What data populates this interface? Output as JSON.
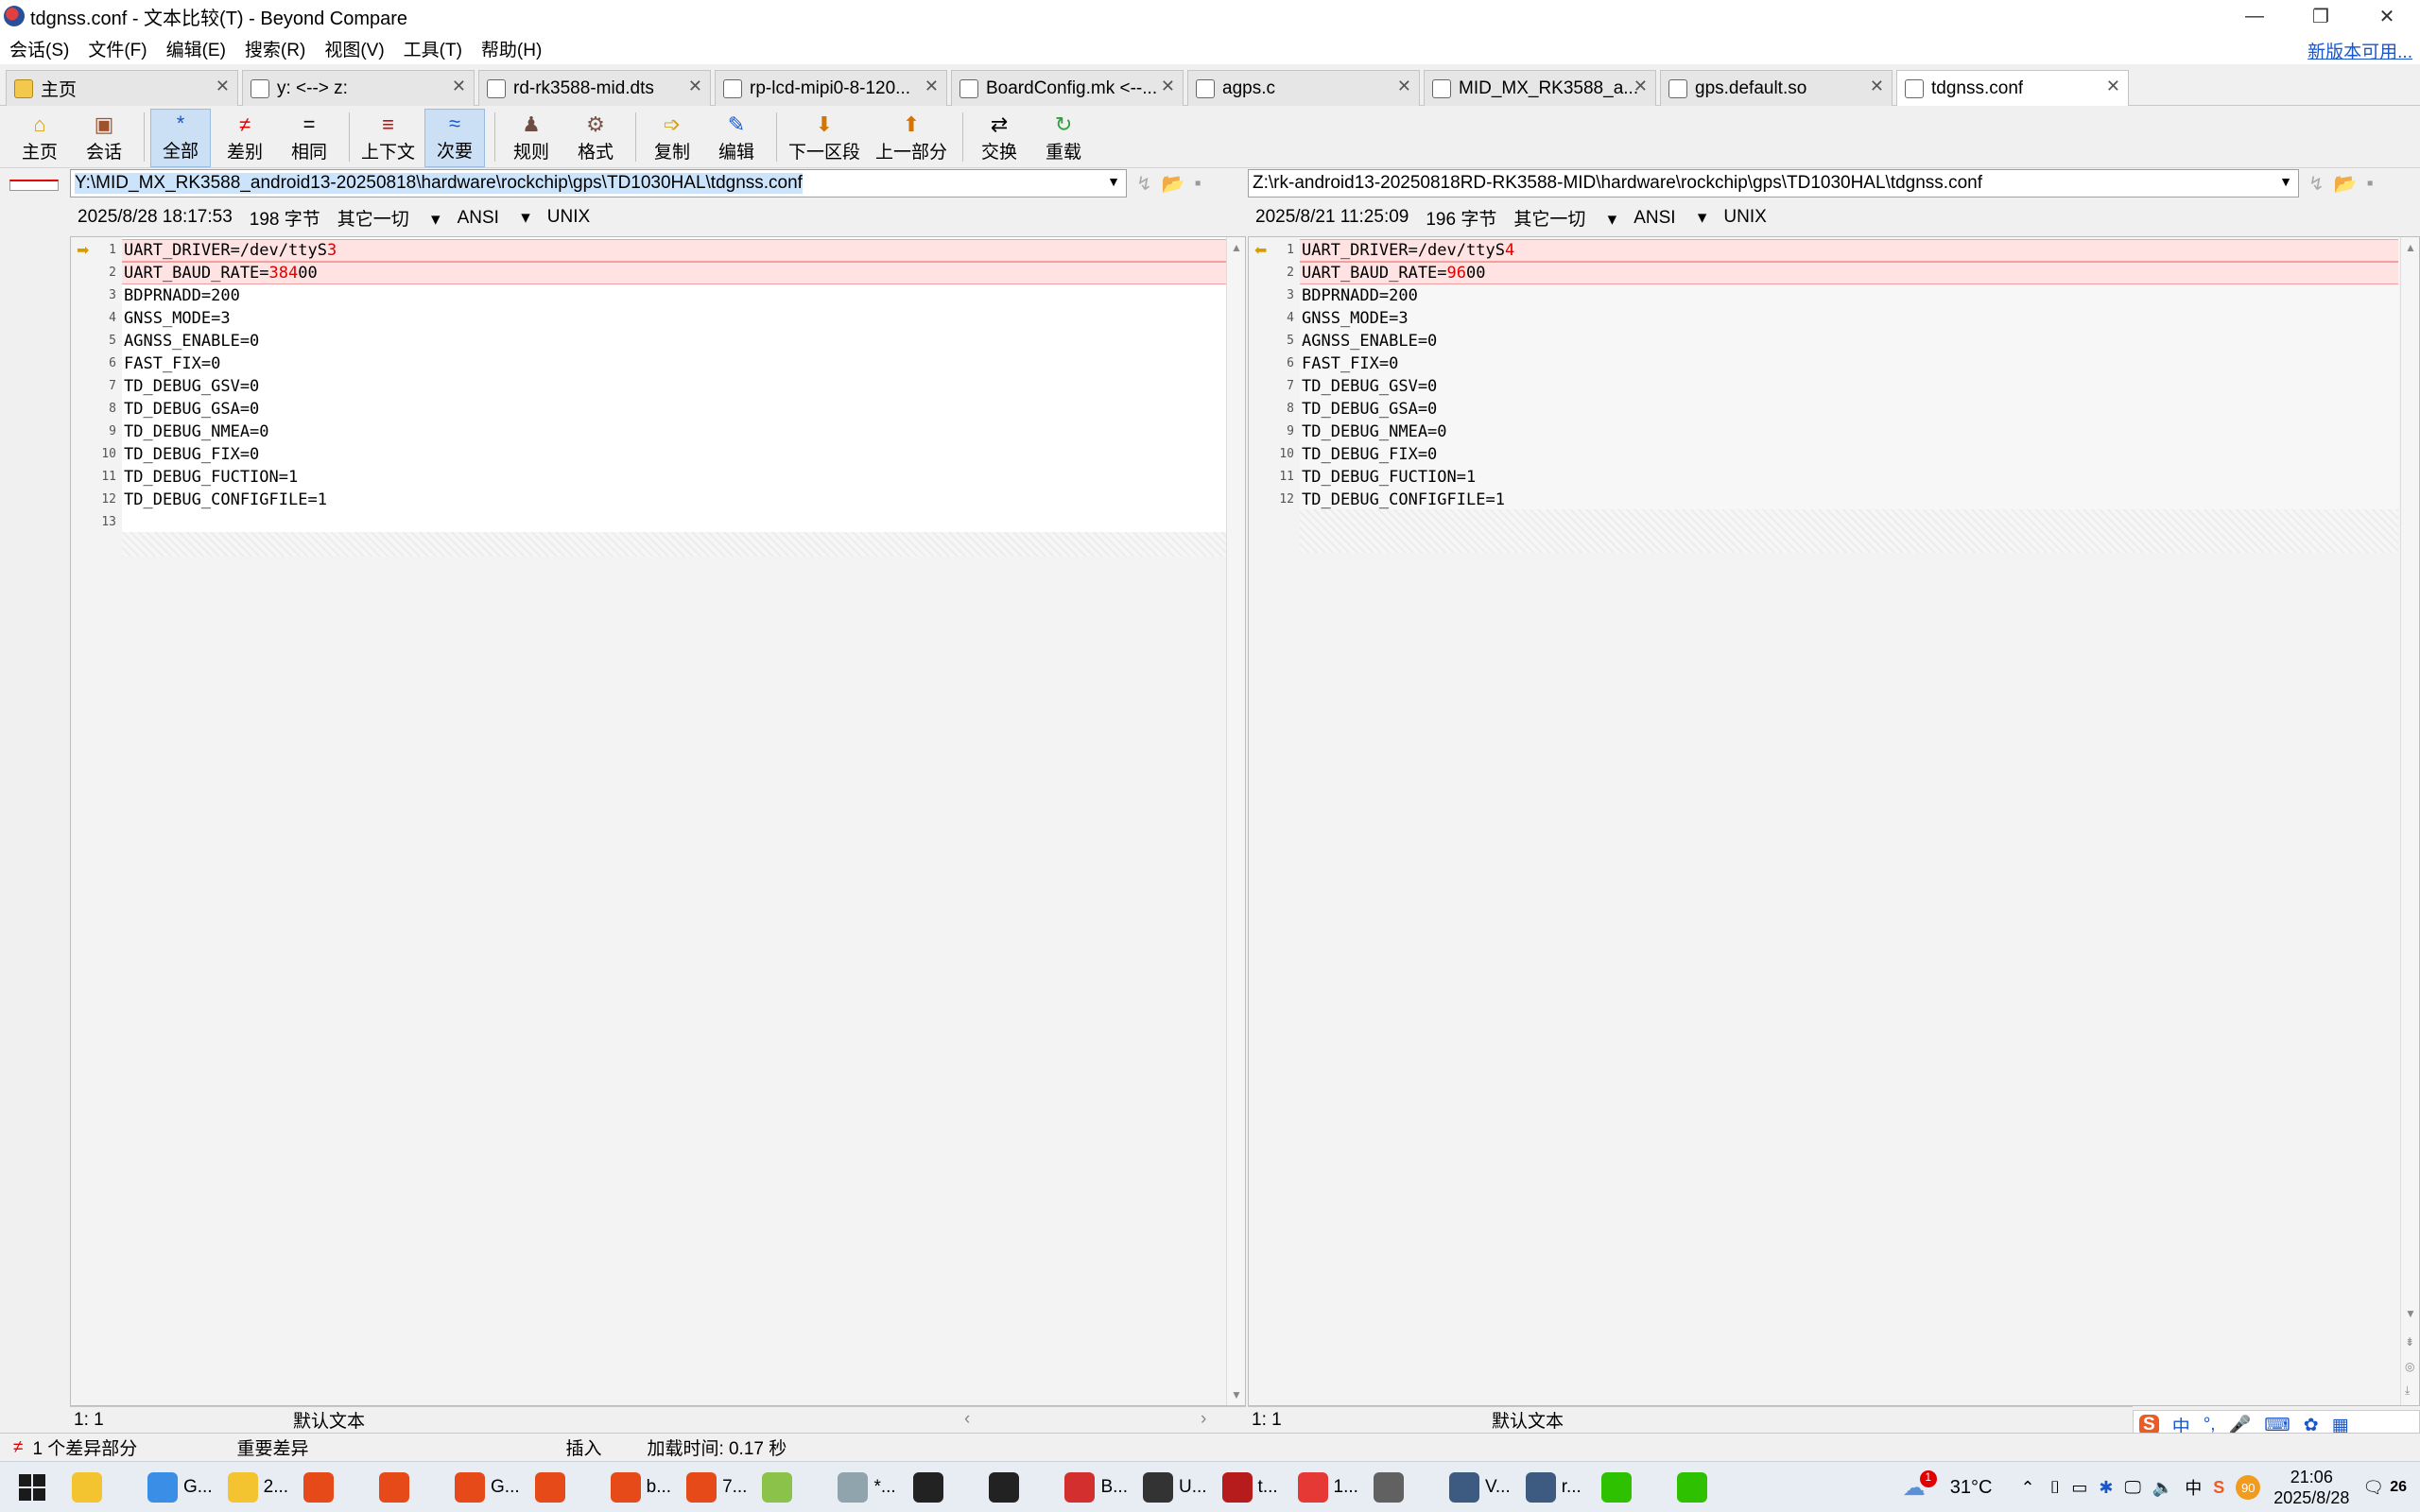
{
  "window": {
    "title": "tdgnss.conf - 文本比较(T) - Beyond Compare",
    "controls": [
      "—",
      "❐",
      "✕"
    ]
  },
  "menu": {
    "items": [
      "会话(S)",
      "文件(F)",
      "编辑(E)",
      "搜索(R)",
      "视图(V)",
      "工具(T)",
      "帮助(H)"
    ],
    "new_version": "新版本可用..."
  },
  "tabs": [
    {
      "label": "主页",
      "icon": "home-icon"
    },
    {
      "label": "y: <--> z:",
      "icon": "folder-compare-icon"
    },
    {
      "label": "rd-rk3588-mid.dts",
      "icon": "file-compare-icon"
    },
    {
      "label": "rp-lcd-mipi0-8-120...",
      "icon": "file-compare-icon"
    },
    {
      "label": "BoardConfig.mk <--...",
      "icon": "file-compare-icon"
    },
    {
      "label": "agps.c",
      "icon": "file-compare-icon"
    },
    {
      "label": "MID_MX_RK3588_a...",
      "icon": "file-compare-icon"
    },
    {
      "label": "gps.default.so",
      "icon": "file-compare-icon"
    },
    {
      "label": "tdgnss.conf",
      "icon": "file-compare-icon"
    }
  ],
  "toolbar": {
    "home": "主页",
    "session": "会话",
    "all": "全部",
    "diffs": "差别",
    "same": "相同",
    "context": "上下文",
    "minor": "次要",
    "rules": "规则",
    "format": "格式",
    "copy": "复制",
    "edit": "编辑",
    "next_section": "下一区段",
    "prev_section": "上一部分",
    "swap": "交换",
    "reload": "重载"
  },
  "left": {
    "path": "Y:\\MID_MX_RK3588_android13-20250818\\hardware\\rockchip\\gps\\TD1030HAL\\tdgnss.conf",
    "date": "2025/8/28 18:17:53",
    "size": "198 字节",
    "other": "其它一切",
    "encoding": "ANSI",
    "eol": "UNIX",
    "status_pos": "1: 1",
    "status_mode": "默认文本",
    "lines": [
      {
        "n": "1",
        "pre": "UART_DRIVER=/dev/ttyS",
        "diff": "3",
        "post": ""
      },
      {
        "n": "2",
        "pre": "UART_BAUD_RATE=",
        "diff": "384",
        "post": "00"
      },
      {
        "n": "3",
        "pre": "BDPRNADD=200",
        "diff": "",
        "post": ""
      },
      {
        "n": "4",
        "pre": "GNSS_MODE=3",
        "diff": "",
        "post": ""
      },
      {
        "n": "5",
        "pre": "AGNSS_ENABLE=0",
        "diff": "",
        "post": ""
      },
      {
        "n": "6",
        "pre": "FAST_FIX=0",
        "diff": "",
        "post": ""
      },
      {
        "n": "7",
        "pre": "TD_DEBUG_GSV=0",
        "diff": "",
        "post": ""
      },
      {
        "n": "8",
        "pre": "TD_DEBUG_GSA=0",
        "diff": "",
        "post": ""
      },
      {
        "n": "9",
        "pre": "TD_DEBUG_NMEA=0",
        "diff": "",
        "post": ""
      },
      {
        "n": "10",
        "pre": "TD_DEBUG_FIX=0",
        "diff": "",
        "post": ""
      },
      {
        "n": "11",
        "pre": "TD_DEBUG_FUCTION=1",
        "diff": "",
        "post": ""
      },
      {
        "n": "12",
        "pre": "TD_DEBUG_CONFIGFILE=1",
        "diff": "",
        "post": ""
      },
      {
        "n": "13",
        "pre": "",
        "diff": "",
        "post": ""
      }
    ]
  },
  "right": {
    "path": "Z:\\rk-android13-20250818RD-RK3588-MID\\hardware\\rockchip\\gps\\TD1030HAL\\tdgnss.conf",
    "date": "2025/8/21 11:25:09",
    "size": "196 字节",
    "other": "其它一切",
    "encoding": "ANSI",
    "eol": "UNIX",
    "status_pos": "1: 1",
    "status_mode": "默认文本",
    "lines": [
      {
        "n": "1",
        "pre": "UART_DRIVER=/dev/ttyS",
        "diff": "4",
        "post": ""
      },
      {
        "n": "2",
        "pre": "UART_BAUD_RATE=",
        "diff": "96",
        "post": "00"
      },
      {
        "n": "3",
        "pre": "BDPRNADD=200",
        "diff": "",
        "post": ""
      },
      {
        "n": "4",
        "pre": "GNSS_MODE=3",
        "diff": "",
        "post": ""
      },
      {
        "n": "5",
        "pre": "AGNSS_ENABLE=0",
        "diff": "",
        "post": ""
      },
      {
        "n": "6",
        "pre": "FAST_FIX=0",
        "diff": "",
        "post": ""
      },
      {
        "n": "7",
        "pre": "TD_DEBUG_GSV=0",
        "diff": "",
        "post": ""
      },
      {
        "n": "8",
        "pre": "TD_DEBUG_GSA=0",
        "diff": "",
        "post": ""
      },
      {
        "n": "9",
        "pre": "TD_DEBUG_NMEA=0",
        "diff": "",
        "post": ""
      },
      {
        "n": "10",
        "pre": "TD_DEBUG_FIX=0",
        "diff": "",
        "post": ""
      },
      {
        "n": "11",
        "pre": "TD_DEBUG_FUCTION=1",
        "diff": "",
        "post": ""
      },
      {
        "n": "12",
        "pre": "TD_DEBUG_CONFIGFILE=1",
        "diff": "",
        "post": ""
      }
    ]
  },
  "status": {
    "diff_count": "1 个差异部分",
    "important": "重要差异",
    "insert": "插入",
    "load_time": "加载时间: 0.17 秒"
  },
  "ime": {
    "lang": "中",
    "punct": "°,"
  },
  "taskbar": {
    "items": [
      {
        "label": "",
        "icon": "file-explorer-icon",
        "color": "#f4c430"
      },
      {
        "label": "G...",
        "icon": "app-icon",
        "color": "#3a8ee6"
      },
      {
        "label": "2...",
        "icon": "folder-icon",
        "color": "#f4c430"
      },
      {
        "label": "",
        "icon": "chrome-icon",
        "color": "#e64a19"
      },
      {
        "label": "",
        "icon": "chrome-icon",
        "color": "#e64a19"
      },
      {
        "label": "G...",
        "icon": "chrome-icon",
        "color": "#e64a19"
      },
      {
        "label": "",
        "icon": "chrome-icon",
        "color": "#e64a19"
      },
      {
        "label": "b...",
        "icon": "chrome-icon",
        "color": "#e64a19"
      },
      {
        "label": "7...",
        "icon": "chrome-icon",
        "color": "#e64a19"
      },
      {
        "label": "",
        "icon": "paint-icon",
        "color": "#8bc34a"
      },
      {
        "label": "*...",
        "icon": "notepad-icon",
        "color": "#90a4ae"
      },
      {
        "label": "",
        "icon": "terminal-icon",
        "color": "#222"
      },
      {
        "label": "",
        "icon": "terminal-icon",
        "color": "#222"
      },
      {
        "label": "B...",
        "icon": "wps-icon",
        "color": "#d32f2f"
      },
      {
        "label": "U...",
        "icon": "ultraedit-icon",
        "color": "#333"
      },
      {
        "label": "t...",
        "icon": "beyond-compare-icon",
        "color": "#b71c1c"
      },
      {
        "label": "1...",
        "icon": "app-icon",
        "color": "#e53935"
      },
      {
        "label": "",
        "icon": "tools-icon",
        "color": "#616161"
      },
      {
        "label": "V...",
        "icon": "app-icon",
        "color": "#3d5a80"
      },
      {
        "label": "r...",
        "icon": "app-icon",
        "color": "#3d5a80"
      },
      {
        "label": "",
        "icon": "wechat-icon",
        "color": "#2dc100"
      },
      {
        "label": "",
        "icon": "wechat-icon",
        "color": "#2dc100"
      }
    ],
    "weather_badge": "1",
    "temp": "31°C",
    "time": "21:06",
    "date": "2025/8/28",
    "badge": "90",
    "ime_lang": "中",
    "notif": "26"
  }
}
